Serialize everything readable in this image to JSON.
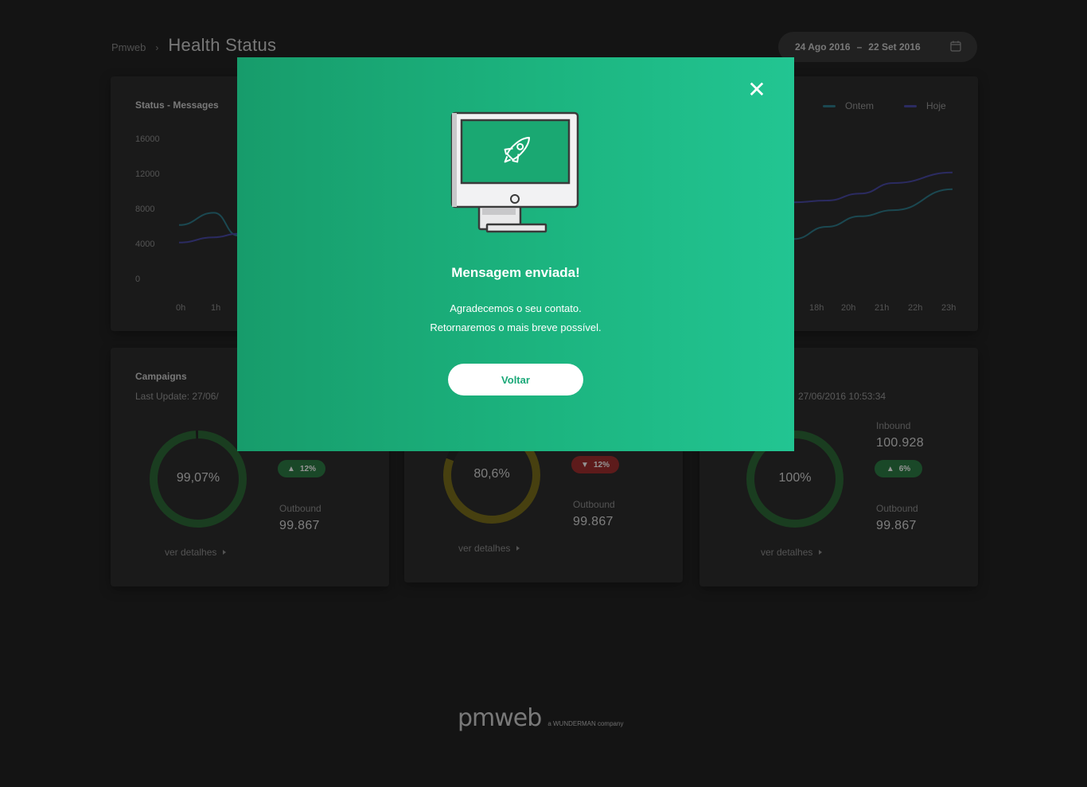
{
  "breadcrumb": {
    "root": "Pmweb",
    "separator": "›",
    "title": "Health Status"
  },
  "date_range": {
    "start": "24 Ago 2016",
    "dash": "–",
    "end": "22 Set 2016"
  },
  "chart": {
    "title": "Status  -  Messages",
    "legend": [
      {
        "label": "Ontem",
        "color": "#2f7d8c"
      },
      {
        "label": "Hoje",
        "color": "#4a4aa8"
      }
    ],
    "y_ticks": [
      "16000",
      "12000",
      "8000",
      "4000",
      "0"
    ],
    "x_ticks_left": [
      "0h",
      "1h"
    ],
    "x_ticks_right": [
      "18h",
      "20h",
      "21h",
      "22h",
      "23h"
    ]
  },
  "chart_data": {
    "type": "line",
    "title": "Status  -  Messages",
    "ylim": [
      0,
      16000
    ],
    "series": [
      {
        "name": "Ontem",
        "x": [
          "0h",
          "1h",
          "2h",
          "19h",
          "20h",
          "21h",
          "22h",
          "23h"
        ],
        "values": [
          6200,
          7600,
          5000,
          4600,
          6000,
          7200,
          7900,
          10300
        ]
      },
      {
        "name": "Hoje",
        "x": [
          "0h",
          "1h",
          "2h",
          "19h",
          "20h",
          "21h",
          "22h",
          "23h"
        ],
        "values": [
          4200,
          4800,
          5200,
          8800,
          9000,
          9800,
          11000,
          12200
        ]
      }
    ],
    "grid": false,
    "legend_position": "top-right"
  },
  "cards": [
    {
      "title": "Campaigns",
      "last_update": "Last Update:  27/06/",
      "percent": "99,07%",
      "percent_value": 99.07,
      "ring_color": "#2e6a38",
      "badge_dir": "up",
      "badge_value": "12",
      "badge_unit": "%",
      "inbound_label": "",
      "inbound_value": "",
      "outbound_label": "Outbound",
      "outbound_value": "99.867",
      "details": "ver detalhes"
    },
    {
      "title": "",
      "last_update": "",
      "percent": "80,6%",
      "percent_value": 80.6,
      "ring_color": "#7a6f1c",
      "badge_dir": "down",
      "badge_value": "12",
      "badge_unit": "%",
      "inbound_label": "",
      "inbound_value": "",
      "outbound_label": "Outbound",
      "outbound_value": "99.867",
      "details": "ver detalhes"
    },
    {
      "title": "",
      "last_update": "27/06/2016  10:53:34",
      "percent": "100%",
      "percent_value": 100,
      "ring_color": "#2e6a38",
      "badge_dir": "up",
      "badge_value": "6",
      "badge_unit": "%",
      "inbound_label": "Inbound",
      "inbound_value": "100.928",
      "outbound_label": "Outbound",
      "outbound_value": "99.867",
      "details": "ver detalhes"
    }
  ],
  "footer": {
    "brand": "pmweb",
    "tagline": "a WUNDERMAN company"
  },
  "modal": {
    "title": "Mensagem enviada!",
    "line1": "Agradecemos o seu contato.",
    "line2": "Retornaremos o mais breve possível.",
    "button": "Voltar",
    "close_icon": "close-icon",
    "illustration_icon": "monitor-rocket-icon",
    "background_colors": [
      "#179c6b",
      "#22c592"
    ]
  }
}
